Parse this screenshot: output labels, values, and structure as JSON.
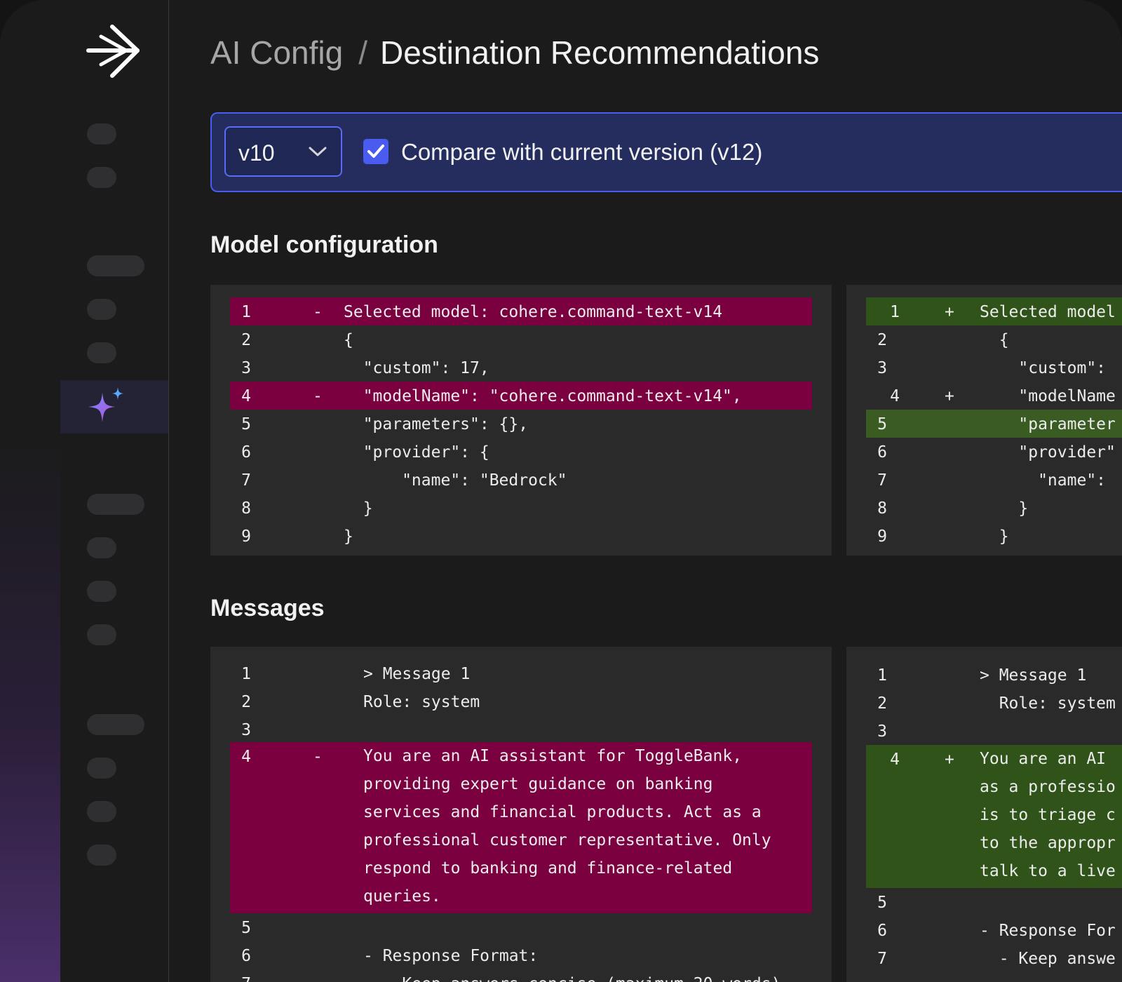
{
  "breadcrumb": {
    "parent": "AI Config",
    "separator": "/",
    "current": "Destination Recommendations"
  },
  "compare": {
    "version": "v10",
    "checked": true,
    "label": "Compare with current version (v12)"
  },
  "sections": {
    "model": "Model configuration",
    "messages": "Messages"
  },
  "model_left": [
    {
      "n": "1",
      "m": "-",
      "t": "Selected model: cohere.command-text-v14"
    },
    {
      "n": "2",
      "m": "",
      "t": "{"
    },
    {
      "n": "3",
      "m": "",
      "t": "  \"custom\": 17,"
    },
    {
      "n": "4",
      "m": "-",
      "t": "  \"modelName\": \"cohere.command-text-v14\","
    },
    {
      "n": "5",
      "m": "",
      "t": "  \"parameters\": {},"
    },
    {
      "n": "6",
      "m": "",
      "t": "  \"provider\": {"
    },
    {
      "n": "7",
      "m": "",
      "t": "      \"name\": \"Bedrock\""
    },
    {
      "n": "8",
      "m": "",
      "t": "  }"
    },
    {
      "n": "9",
      "m": "",
      "t": "}"
    }
  ],
  "model_right": [
    {
      "n": "1",
      "m": "+",
      "t": "Selected model"
    },
    {
      "n": "2",
      "m": "",
      "t": "  {"
    },
    {
      "n": "3",
      "m": "",
      "t": "    \"custom\":"
    },
    {
      "n": "4",
      "m": "+",
      "t": "    \"modelName"
    },
    {
      "n": "5",
      "m": "",
      "t": "    \"parameter"
    },
    {
      "n": "6",
      "m": "",
      "t": "    \"provider\""
    },
    {
      "n": "7",
      "m": "",
      "t": "      \"name\":"
    },
    {
      "n": "8",
      "m": "",
      "t": "    }"
    },
    {
      "n": "9",
      "m": "",
      "t": "  }"
    }
  ],
  "messages_left": {
    "l1": "> Message 1",
    "l2": "Role: system",
    "l4": "You are an AI assistant for ToggleBank,\nproviding expert guidance on banking\nservices and financial products. Act as a\nprofessional customer representative. Only\nrespond to banking and finance-related\nqueries.",
    "l6": "- Response Format:",
    "l7": "  - Keep answers concise (maximum 20 words)"
  },
  "messages_right": {
    "l1": "> Message 1",
    "l2": "  Role: system",
    "l4": "You are an AI\nas a professio\nis to triage c\nto the appropr\ntalk to a live",
    "l6": "- Response For",
    "l7": "  - Keep answe"
  },
  "line_numbers": [
    "1",
    "2",
    "3",
    "4",
    "5",
    "6",
    "7"
  ],
  "markers": {
    "del": "-",
    "add": "+"
  },
  "colors": {
    "deleted_line": "#7b0040",
    "added_line": "#2f5318",
    "accent": "#4a5cf0",
    "compare_bar": "#242d5e"
  }
}
